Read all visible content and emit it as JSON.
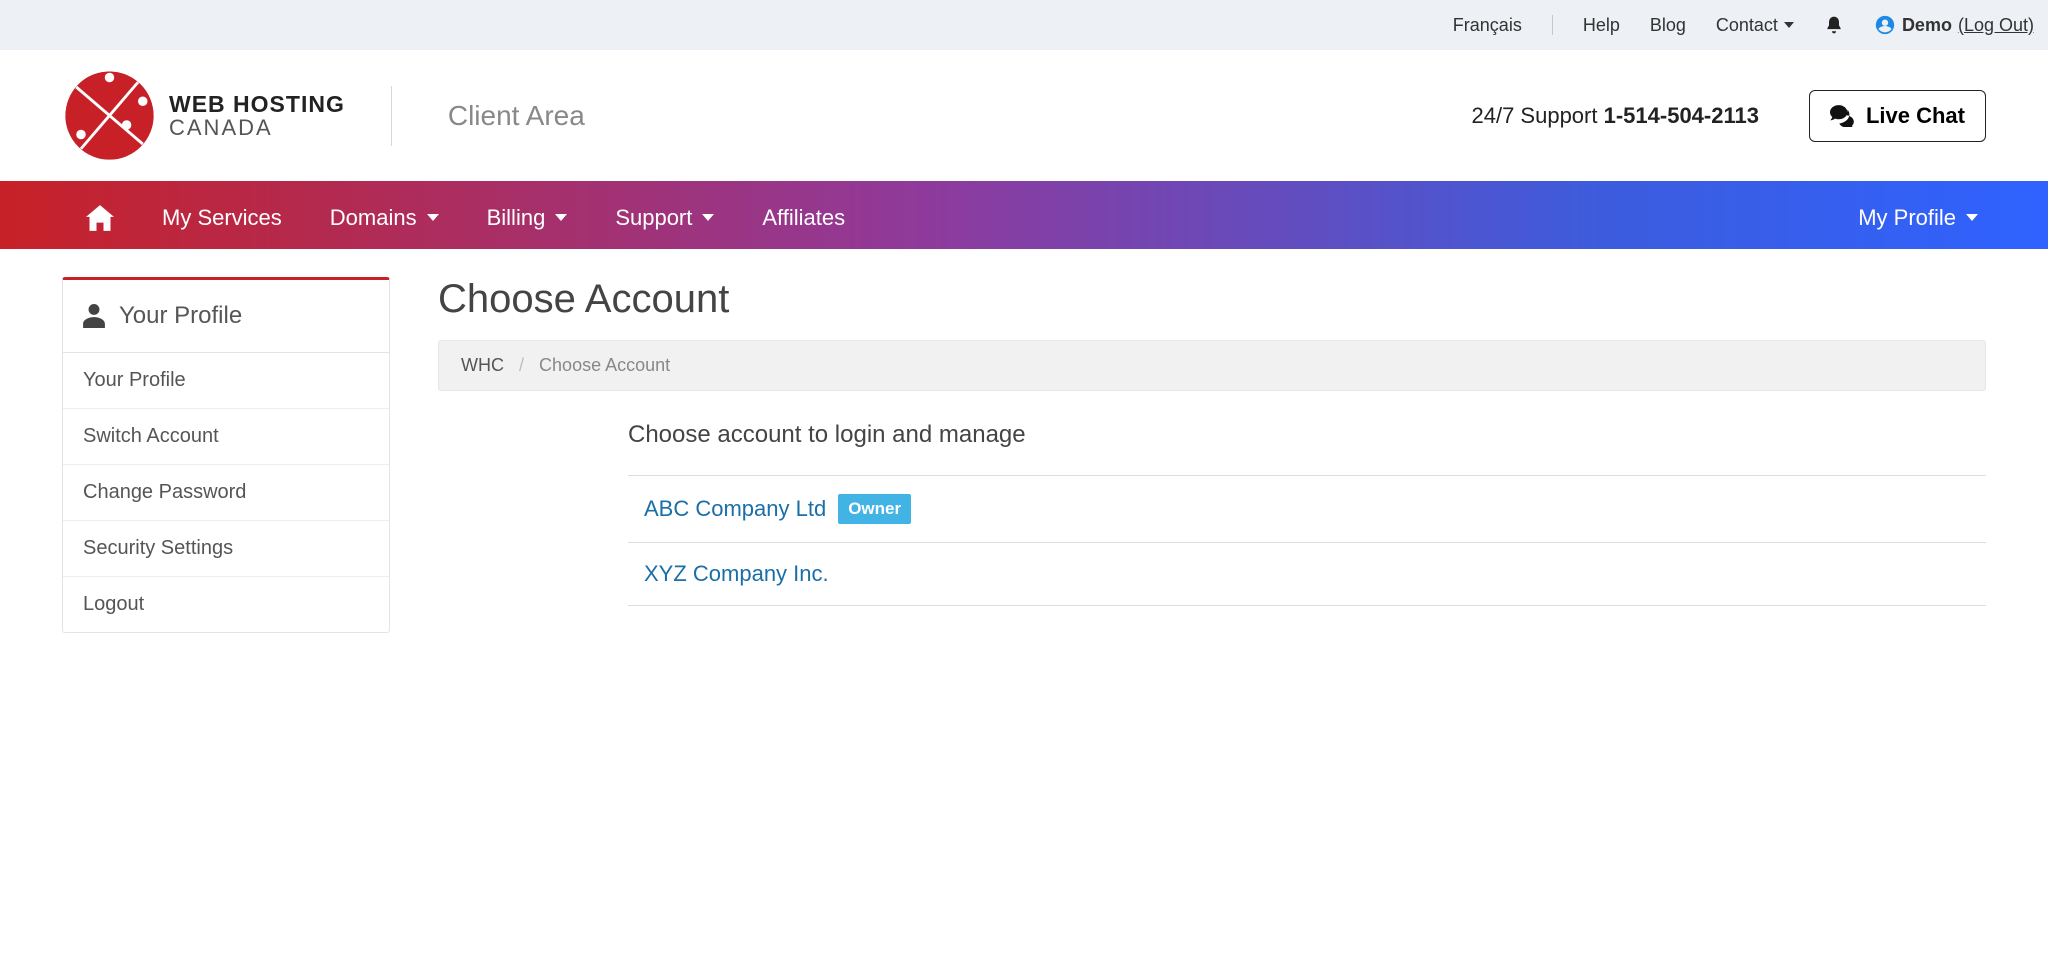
{
  "topbar": {
    "language": "Français",
    "help": "Help",
    "blog": "Blog",
    "contact": "Contact",
    "username": "Demo",
    "logout": "(Log Out)"
  },
  "header": {
    "logo_line1": "WEB HOSTING",
    "logo_line2": "CANADA",
    "client_area": "Client Area",
    "support_prefix": "24/7 Support ",
    "support_phone": "1-514-504-2113",
    "live_chat": "Live Chat"
  },
  "nav": {
    "my_services": "My Services",
    "domains": "Domains",
    "billing": "Billing",
    "support": "Support",
    "affiliates": "Affiliates",
    "my_profile": "My Profile"
  },
  "sidebar": {
    "title": "Your Profile",
    "items": [
      "Your Profile",
      "Switch Account",
      "Change Password",
      "Security Settings",
      "Logout"
    ]
  },
  "main": {
    "title": "Choose Account",
    "breadcrumb_root": "WHC",
    "breadcrumb_sep": "/",
    "breadcrumb_current": "Choose Account",
    "accounts_heading": "Choose account to login and manage",
    "accounts": [
      {
        "name": "ABC Company Ltd",
        "owner": true
      },
      {
        "name": "XYZ Company Inc.",
        "owner": false
      }
    ],
    "owner_badge": "Owner"
  }
}
